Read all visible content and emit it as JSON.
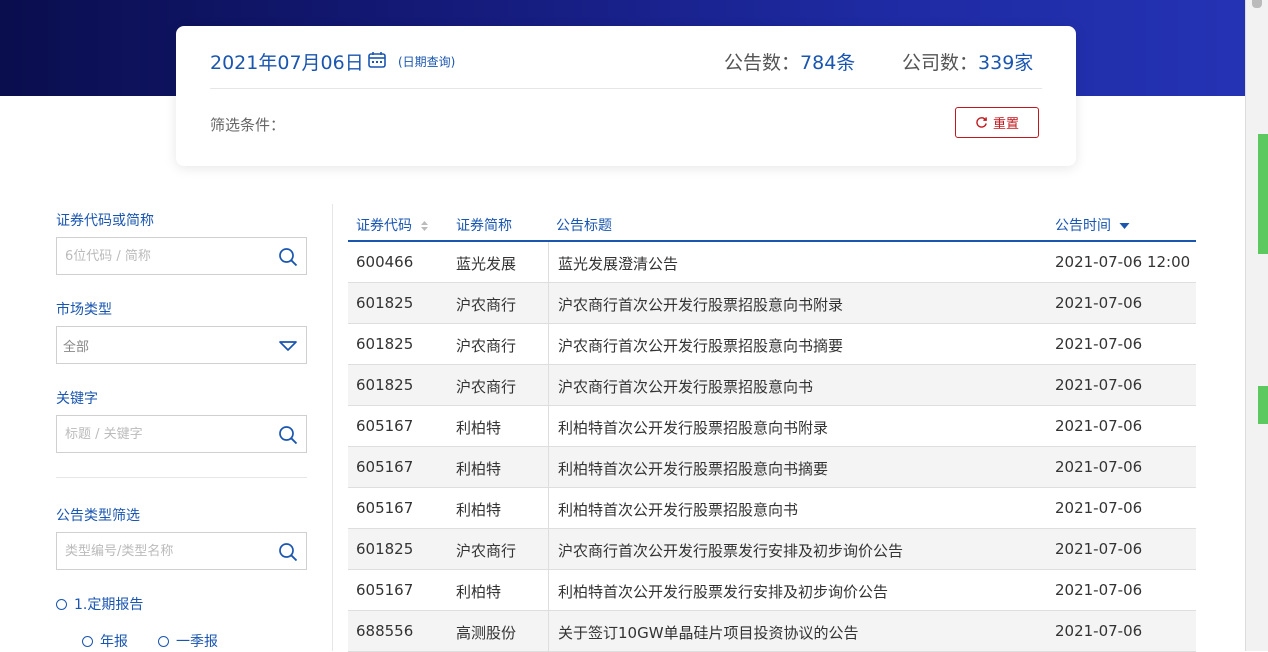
{
  "header": {
    "date": "2021年07月06日",
    "date_query_label": "(日期查询)",
    "announcements_label": "公告数：",
    "announcements_count": "784条",
    "companies_label": "公司数：",
    "companies_count": "339家",
    "filter_label": "筛选条件：",
    "reset_label": "重置"
  },
  "sidebar": {
    "code_label": "证券代码或简称",
    "code_placeholder": "6位代码 / 简称",
    "market_label": "市场类型",
    "market_value": "全部",
    "keyword_label": "关键字",
    "keyword_placeholder": "标题 / 关键字",
    "type_filter_label": "公告类型筛选",
    "type_placeholder": "类型编号/类型名称",
    "periodic_report_label": "1.定期报告",
    "annual_report_label": "年报",
    "q1_report_label": "一季报"
  },
  "table": {
    "headers": {
      "code": "证券代码",
      "name": "证券简称",
      "title": "公告标题",
      "time": "公告时间"
    },
    "rows": [
      {
        "code": "600466",
        "name": "蓝光发展",
        "title": "蓝光发展澄清公告",
        "time": "2021-07-06 12:00"
      },
      {
        "code": "601825",
        "name": "沪农商行",
        "title": "沪农商行首次公开发行股票招股意向书附录",
        "time": "2021-07-06"
      },
      {
        "code": "601825",
        "name": "沪农商行",
        "title": "沪农商行首次公开发行股票招股意向书摘要",
        "time": "2021-07-06"
      },
      {
        "code": "601825",
        "name": "沪农商行",
        "title": "沪农商行首次公开发行股票招股意向书",
        "time": "2021-07-06"
      },
      {
        "code": "605167",
        "name": "利柏特",
        "title": "利柏特首次公开发行股票招股意向书附录",
        "time": "2021-07-06"
      },
      {
        "code": "605167",
        "name": "利柏特",
        "title": "利柏特首次公开发行股票招股意向书摘要",
        "time": "2021-07-06"
      },
      {
        "code": "605167",
        "name": "利柏特",
        "title": "利柏特首次公开发行股票招股意向书",
        "time": "2021-07-06"
      },
      {
        "code": "601825",
        "name": "沪农商行",
        "title": "沪农商行首次公开发行股票发行安排及初步询价公告",
        "time": "2021-07-06"
      },
      {
        "code": "605167",
        "name": "利柏特",
        "title": "利柏特首次公开发行股票发行安排及初步询价公告",
        "time": "2021-07-06"
      },
      {
        "code": "688556",
        "name": "高测股份",
        "title": "关于签订10GW单晶硅片项目投资协议的公告",
        "time": "2021-07-06"
      }
    ]
  },
  "colors": {
    "accent": "#1a56b0",
    "reset_red": "#c0181e",
    "banner_dark": "#0a0e4e"
  },
  "icons": {
    "calendar": "calendar-icon",
    "search": "search-icon",
    "dropdown": "chevron-down-icon",
    "refresh": "refresh-icon",
    "sort": "sort-icon"
  }
}
